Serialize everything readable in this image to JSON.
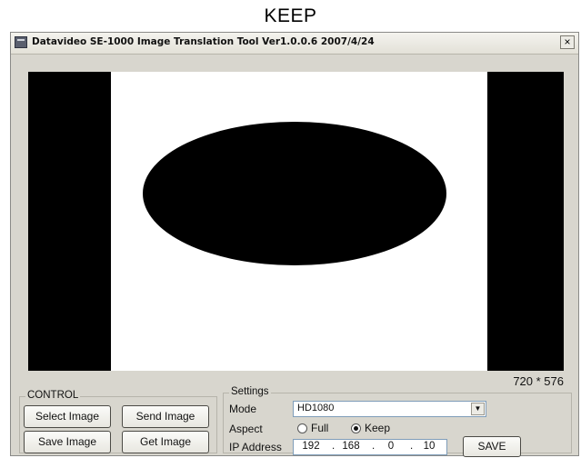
{
  "caption": "KEEP",
  "window": {
    "title": "Datavideo SE-1000 Image Translation Tool Ver1.0.0.6 2007/4/24",
    "close_glyph": "×"
  },
  "preview": {
    "resolution": "720 * 576"
  },
  "control": {
    "label": "CONTROL",
    "buttons": {
      "select_image": "Select Image",
      "send_image": "Send Image",
      "save_image": "Save Image",
      "get_image": "Get Image"
    }
  },
  "settings": {
    "label": "Settings",
    "mode_label": "Mode",
    "mode_value": "HD1080",
    "aspect_label": "Aspect",
    "aspect_options": [
      "Full",
      "Keep"
    ],
    "aspect_selected": "Keep",
    "ip_label": "IP Address",
    "ip_octets": [
      "192",
      "168",
      "0",
      "10"
    ],
    "save_label": "SAVE"
  },
  "icons": [
    "app-icon",
    "close-icon",
    "dropdown-arrow-icon"
  ]
}
